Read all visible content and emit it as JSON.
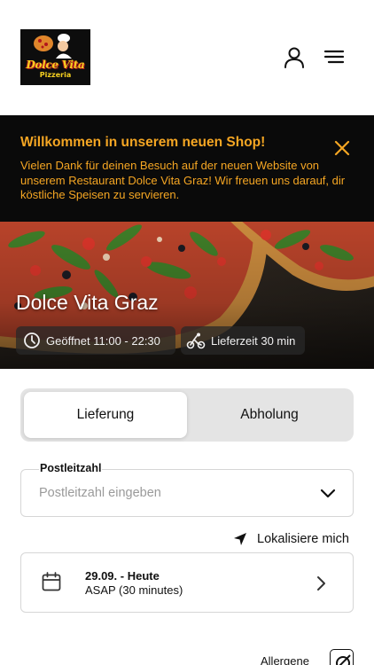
{
  "header": {
    "logo_text": "Dolce Vita",
    "logo_subtext": "Pizzeria",
    "user_icon": "user-icon",
    "menu_icon": "hamburger-menu-icon"
  },
  "banner": {
    "title": "Willkommen in unserem neuen Shop!",
    "text": "Vielen Dank für deinen Besuch auf der neuen Website von unserem Restaurant Dolce Vita Graz! Wir freuen uns darauf, dir köstliche Speisen zu servieren.",
    "close_icon": "close-icon",
    "accent_color": "#f5a623",
    "background_color": "#0a0a0a"
  },
  "hero": {
    "title": "Dolce Vita Graz",
    "opening_hours": "Geöffnet 11:00 - 22:30",
    "delivery_time": "Lieferzeit 30 min"
  },
  "order_mode": {
    "options": [
      "Lieferung",
      "Abholung"
    ],
    "selected": "Lieferung"
  },
  "postal": {
    "label": "Postleitzahl",
    "placeholder": "Postleitzahl eingeben",
    "value": ""
  },
  "locate": {
    "label": "Lokalisiere mich"
  },
  "schedule": {
    "date": "29.09. - Heute",
    "time": "ASAP (30 minutes)"
  },
  "allergens": {
    "label": "Allergene"
  }
}
